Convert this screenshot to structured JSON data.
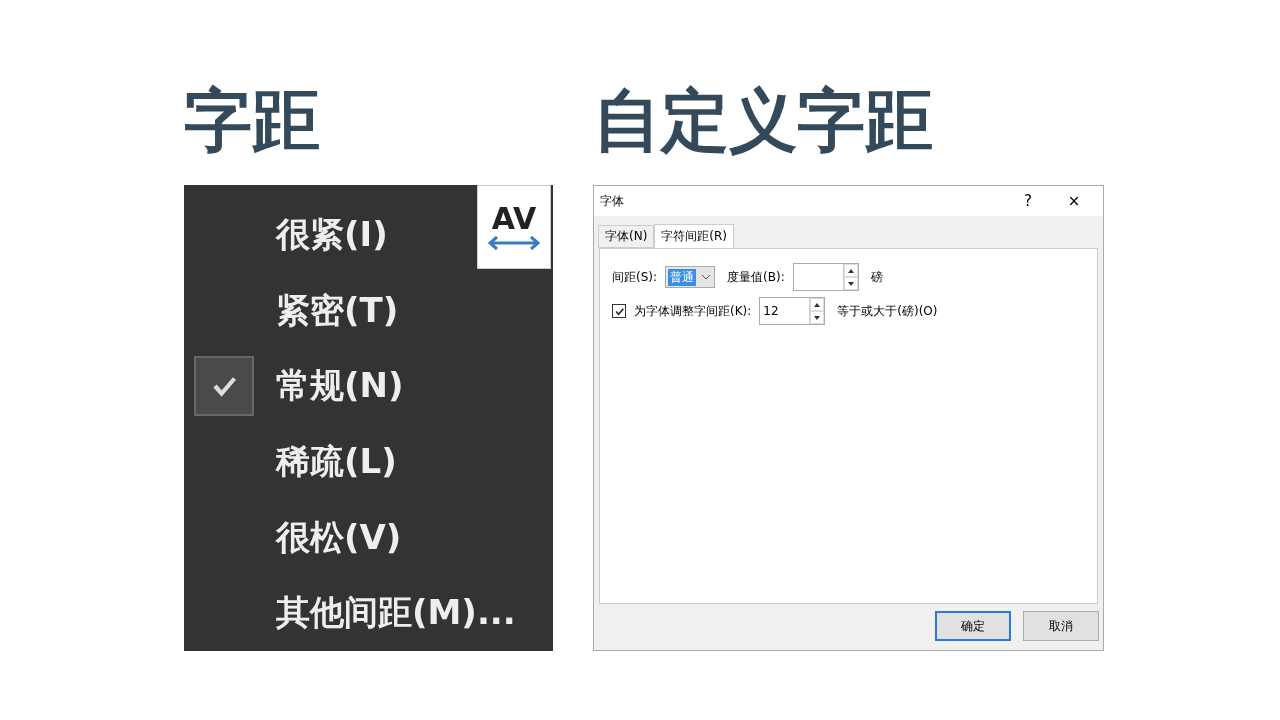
{
  "headings": [
    "字距",
    "自定义字距"
  ],
  "menu": {
    "icon_text": "AV",
    "items": [
      {
        "label": "很紧(I)",
        "checked": false
      },
      {
        "label": "紧密(T)",
        "checked": false
      },
      {
        "label": "常规(N)",
        "checked": true
      },
      {
        "label": "稀疏(L)",
        "checked": false
      },
      {
        "label": "很松(V)",
        "checked": false
      },
      {
        "label": "其他间距(M)...",
        "checked": false
      }
    ]
  },
  "dialog": {
    "title": "字体",
    "help": "?",
    "close": "×",
    "tabs": [
      {
        "label": "字体(N)",
        "selected": false
      },
      {
        "label": "字符间距(R)",
        "selected": true
      }
    ],
    "spacing": {
      "label": "间距(S):",
      "value": "普通",
      "amount_label": "度量值(B):",
      "unit": "磅"
    },
    "kerning": {
      "checked": true,
      "label": "为字体调整字间距(K):",
      "value": "12",
      "suffix": "等于或大于(磅)(O)"
    },
    "buttons": [
      {
        "label": "确定",
        "default": true
      },
      {
        "label": "取消",
        "default": false
      }
    ]
  }
}
